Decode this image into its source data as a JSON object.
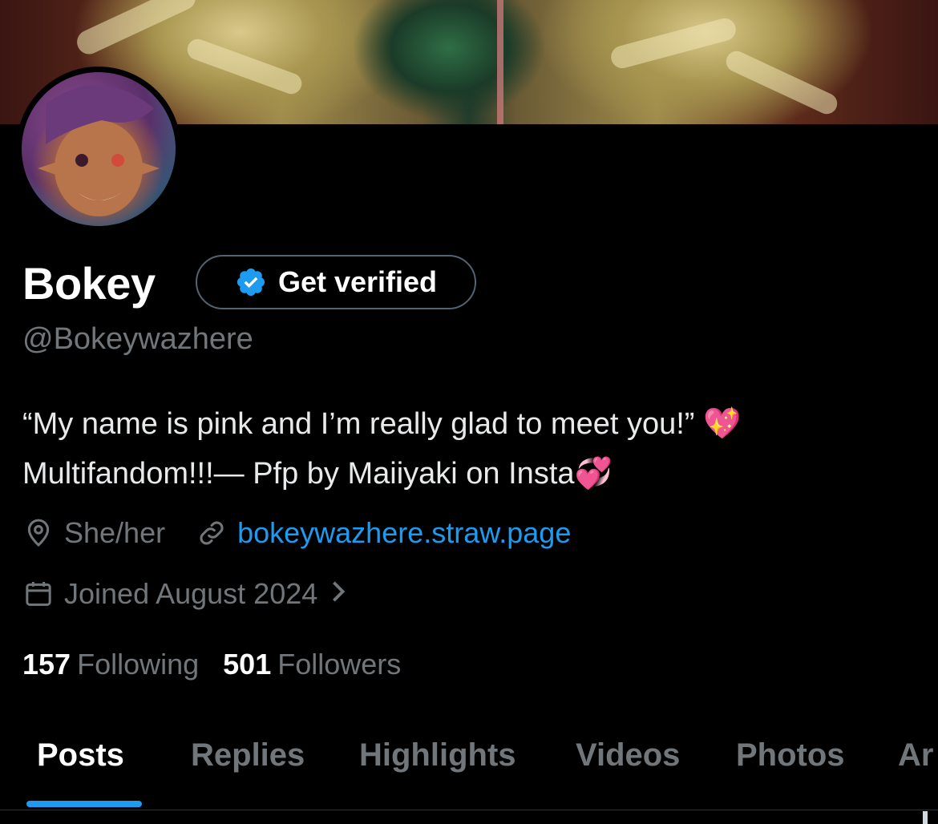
{
  "profile": {
    "display_name": "Bokey",
    "verify_label": "Get verified",
    "handle": "@Bokeywazhere",
    "bio_line1": "“My name is pink and I’m really glad to meet you!” 💖",
    "bio_line2": "Multifandom!!!— Pfp by Maiiyaki on Insta💞",
    "location": "She/her",
    "website": "bokeywazhere.straw.page",
    "joined": "Joined August 2024",
    "following_count": "157",
    "following_label": "Following",
    "followers_count": "501",
    "followers_label": "Followers"
  },
  "tabs": [
    {
      "label": "Posts",
      "active": true
    },
    {
      "label": "Replies",
      "active": false
    },
    {
      "label": "Highlights",
      "active": false
    },
    {
      "label": "Videos",
      "active": false
    },
    {
      "label": "Photos",
      "active": false
    },
    {
      "label": "Ar",
      "active": false
    }
  ],
  "colors": {
    "accent": "#1d9bf0",
    "muted": "#71767b",
    "background": "#000000"
  },
  "icons": {
    "verify": "verified-badge-icon",
    "location": "location-pin-icon",
    "website": "link-icon",
    "joined": "calendar-icon",
    "joined_more": "chevron-right-icon"
  }
}
